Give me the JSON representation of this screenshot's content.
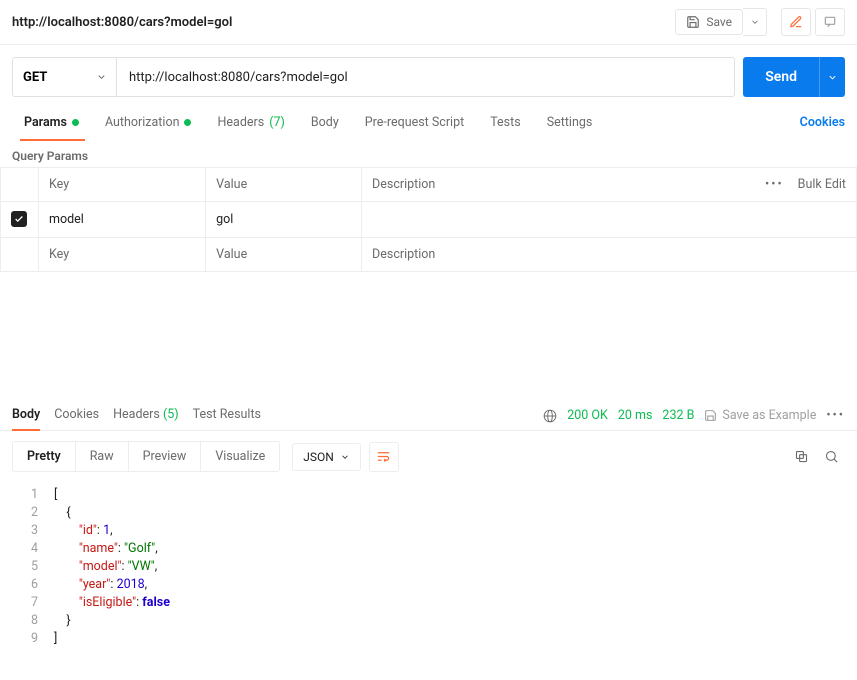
{
  "breadcrumb": "http://localhost:8080/cars?model=gol",
  "save_label": "Save",
  "method": "GET",
  "url": "http://localhost:8080/cars?model=gol",
  "send_label": "Send",
  "tabs": {
    "params": "Params",
    "auth": "Authorization",
    "headers": "Headers",
    "headers_count": "(7)",
    "body": "Body",
    "pre": "Pre-request Script",
    "tests": "Tests",
    "settings": "Settings"
  },
  "cookies_link": "Cookies",
  "section_label": "Query Params",
  "param_headers": {
    "key": "Key",
    "value": "Value",
    "desc": "Description",
    "bulk": "Bulk Edit"
  },
  "param_row": {
    "key": "model",
    "value": "gol"
  },
  "placeholders": {
    "key": "Key",
    "value": "Value",
    "desc": "Description"
  },
  "resp_tabs": {
    "body": "Body",
    "cookies": "Cookies",
    "headers": "Headers",
    "headers_count": "(5)",
    "tests": "Test Results"
  },
  "status": {
    "code": "200",
    "text": "OK",
    "time": "20 ms",
    "size": "232 B"
  },
  "save_example": "Save as Example",
  "view": {
    "pretty": "Pretty",
    "raw": "Raw",
    "preview": "Preview",
    "visualize": "Visualize",
    "format": "JSON"
  },
  "json_body": [
    {
      "id": 1,
      "name": "Golf",
      "model": "VW",
      "year": 2018,
      "isEligible": false
    }
  ]
}
